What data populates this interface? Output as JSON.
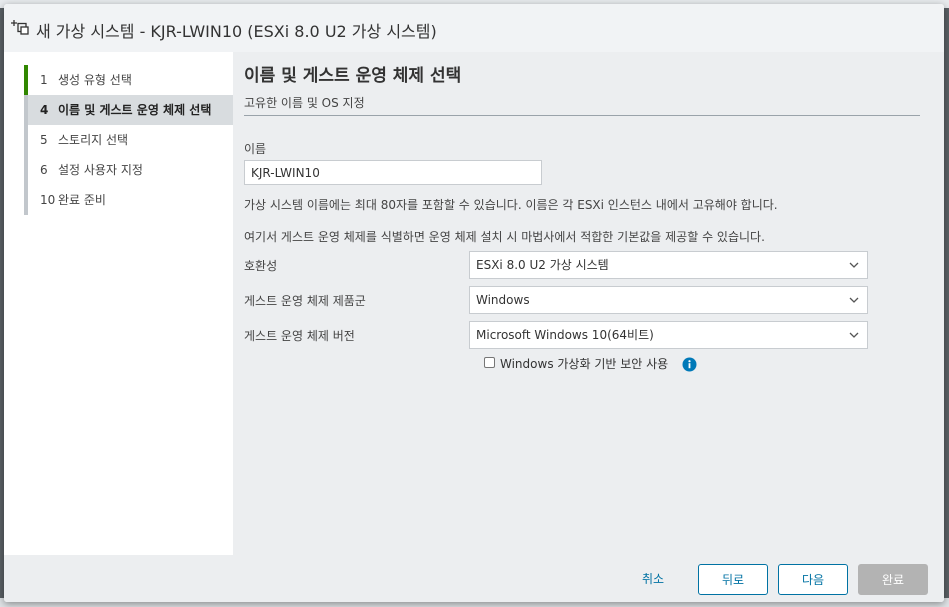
{
  "window": {
    "title": "새 가상 시스템 - KJR-LWIN10 (ESXi 8.0 U2 가상 시스템)"
  },
  "steps": [
    {
      "num": "1",
      "label": "생성 유형 선택",
      "state": "done"
    },
    {
      "num": "4",
      "label": "이름 및 게스트 운영 체제 선택",
      "state": "current"
    },
    {
      "num": "5",
      "label": "스토리지 선택",
      "state": "pending"
    },
    {
      "num": "6",
      "label": "설정 사용자 지정",
      "state": "pending"
    },
    {
      "num": "10",
      "label": "완료 준비",
      "state": "pending"
    }
  ],
  "page": {
    "title": "이름 및 게스트 운영 체제 선택",
    "subtitle": "고유한 이름 및 OS 지정"
  },
  "form": {
    "name_label": "이름",
    "name_value": "KJR-LWIN10",
    "name_hint": "가상 시스템 이름에는 최대 80자를 포함할 수 있습니다. 이름은 각 ESXi 인스턴스 내에서 고유해야 합니다.",
    "guest_hint": "여기서 게스트 운영 체제를 식별하면 운영 체제 설치 시 마법사에서 적합한 기본값을 제공할 수 있습니다.",
    "compatibility_label": "호환성",
    "compatibility_value": "ESXi 8.0 U2 가상 시스템",
    "os_family_label": "게스트 운영 체제 제품군",
    "os_family_value": "Windows",
    "os_version_label": "게스트 운영 체제 버전",
    "os_version_value": "Microsoft Windows 10(64비트)",
    "vbs_label": "Windows 가상화 기반 보안 사용",
    "vbs_checked": false
  },
  "footer": {
    "cancel_label": "취소",
    "back_label": "뒤로",
    "next_label": "다음",
    "finish_label": "완료"
  },
  "colors": {
    "accent": "#0072a3",
    "step_active": "#318700",
    "info": "#0079b8",
    "disabled": "#b3b3b3"
  }
}
